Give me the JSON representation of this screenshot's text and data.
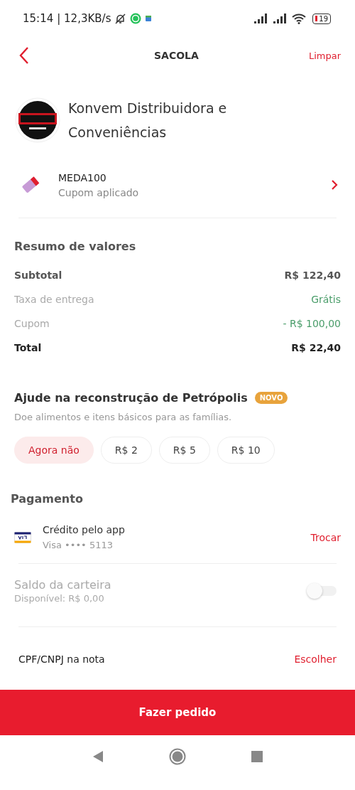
{
  "status_bar": {
    "time": "15:14",
    "speed": "| 12,3KB/s",
    "battery": "19"
  },
  "header": {
    "title": "SACOLA",
    "action": "Limpar"
  },
  "store": {
    "name": "Konvem Distribuidora e Conveniências"
  },
  "coupon": {
    "code": "MEDA100",
    "status": "Cupom aplicado"
  },
  "summary": {
    "title": "Resumo de valores",
    "rows": [
      {
        "kind": "subtotal",
        "label": "Subtotal",
        "value": "R$ 122,40"
      },
      {
        "kind": "fee",
        "label": "Taxa de entrega",
        "value": "Grátis"
      },
      {
        "kind": "discount",
        "label": "Cupom",
        "value": "- R$ 100,00"
      },
      {
        "kind": "total",
        "label": "Total",
        "value": "R$ 22,40"
      }
    ]
  },
  "donation": {
    "title": "Ajude na reconstrução de Petrópolis",
    "badge": "NOVO",
    "subtitle": "Doe alimentos e itens básicos para as famílias.",
    "options": [
      {
        "label": "Agora não",
        "selected": true
      },
      {
        "label": "R$ 2",
        "selected": false
      },
      {
        "label": "R$ 5",
        "selected": false
      },
      {
        "label": "R$ 10",
        "selected": false
      }
    ]
  },
  "payment": {
    "title": "Pagamento",
    "method": "Crédito pelo app",
    "card": "Visa •••• 5113",
    "action": "Trocar"
  },
  "wallet": {
    "title": "Saldo da carteira",
    "available": "Disponível: R$ 0,00",
    "disabled": true,
    "on": false
  },
  "invoice": {
    "label": "CPF/CNPJ na nota",
    "action": "Escolher"
  },
  "order_button": "Fazer pedido"
}
